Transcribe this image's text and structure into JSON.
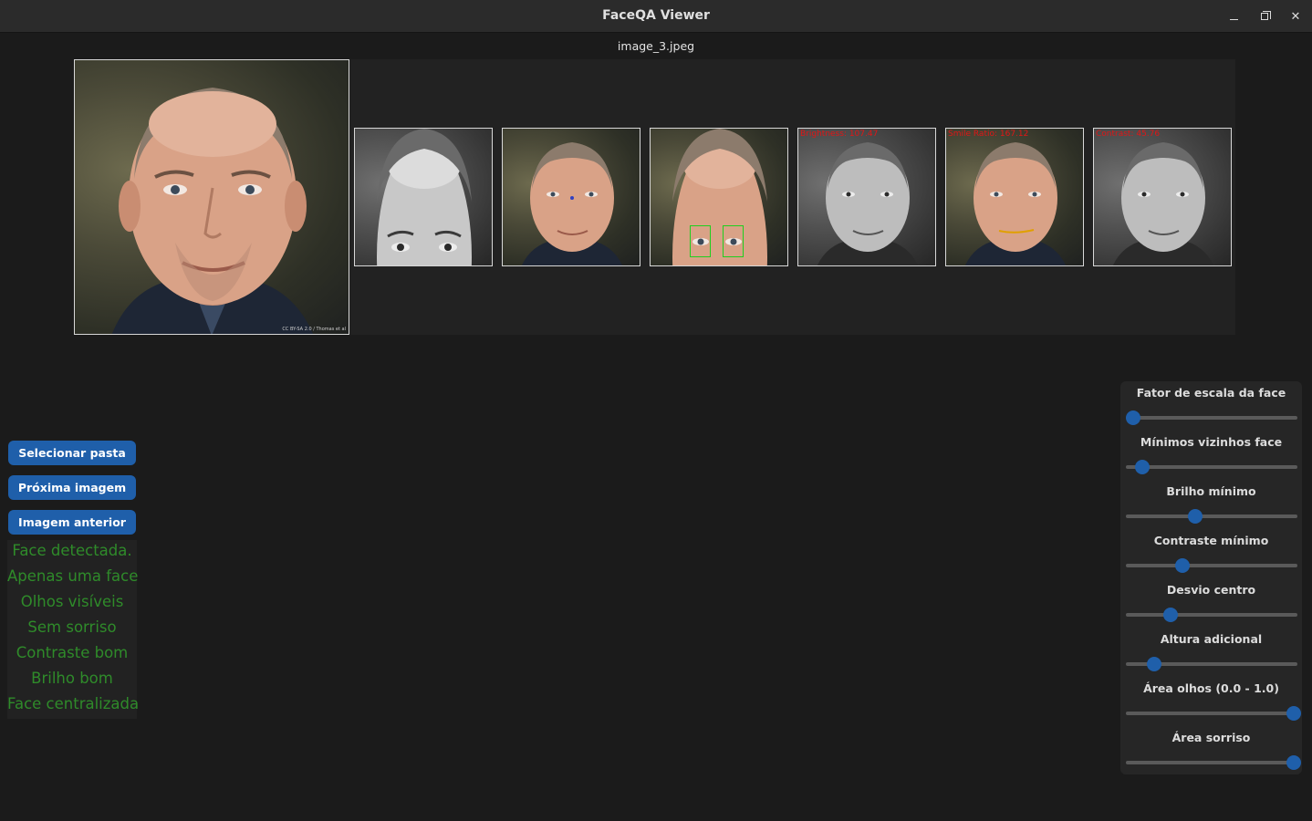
{
  "window": {
    "title": "FaceQA Viewer",
    "controls": [
      "minimize",
      "maximize",
      "close"
    ]
  },
  "image": {
    "filename": "image_3.jpeg",
    "main_credit": "CC BY-SA 2.0 / Thomas et al",
    "thumbnails": [
      {
        "kind": "gray-forehead",
        "caption": ""
      },
      {
        "kind": "color-center-dot",
        "caption": ""
      },
      {
        "kind": "color-eyes",
        "caption": ""
      },
      {
        "kind": "gray-brightness",
        "caption": "Brightness: 107.47"
      },
      {
        "kind": "color-smile",
        "caption": "Smile Ratio: 167.12"
      },
      {
        "kind": "gray-contrast",
        "caption": "Contrast: 45.76"
      }
    ]
  },
  "buttons": {
    "select_folder": "Selecionar pasta",
    "next_image": "Próxima imagem",
    "prev_image": "Imagem anterior"
  },
  "status": [
    "Face detectada.",
    "Apenas uma face",
    "Olhos visíveis",
    "Sem sorriso",
    "Contraste bom",
    "Brilho bom",
    "Face centralizada"
  ],
  "status_color": "#2f8b2a",
  "accent_color": "#1f5faa",
  "sliders": [
    {
      "label": "Fator de escala da face",
      "value": 0.02
    },
    {
      "label": "Mínimos vizinhos face",
      "value": 0.08
    },
    {
      "label": "Brilho mínimo",
      "value": 0.4
    },
    {
      "label": "Contraste mínimo",
      "value": 0.32
    },
    {
      "label": "Desvio centro",
      "value": 0.25
    },
    {
      "label": "Altura adicional",
      "value": 0.15
    },
    {
      "label": "Área olhos (0.0 - 1.0)",
      "value": 1.0
    },
    {
      "label": "Área sorriso",
      "value": 1.0
    }
  ]
}
